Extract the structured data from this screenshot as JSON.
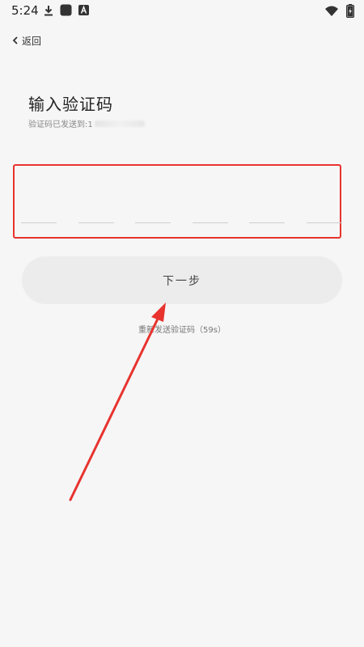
{
  "status_bar": {
    "time": "5:24",
    "left_icons": [
      "download-icon",
      "app-square-icon",
      "a-letter-icon"
    ],
    "right_icons": [
      "wifi-icon",
      "battery-charging-icon"
    ]
  },
  "nav": {
    "back_label": "返回",
    "back_icon": "chevron-left-icon"
  },
  "title": "输入验证码",
  "subtitle_prefix": "验证码已发送到:1",
  "code_slots_count": 6,
  "next_button_label": "下一步",
  "resend_label": "重新发送验证码（59s）",
  "colors": {
    "background": "#f6f6f6",
    "highlight_red": "#e8332f",
    "button_bg": "#ececec"
  }
}
